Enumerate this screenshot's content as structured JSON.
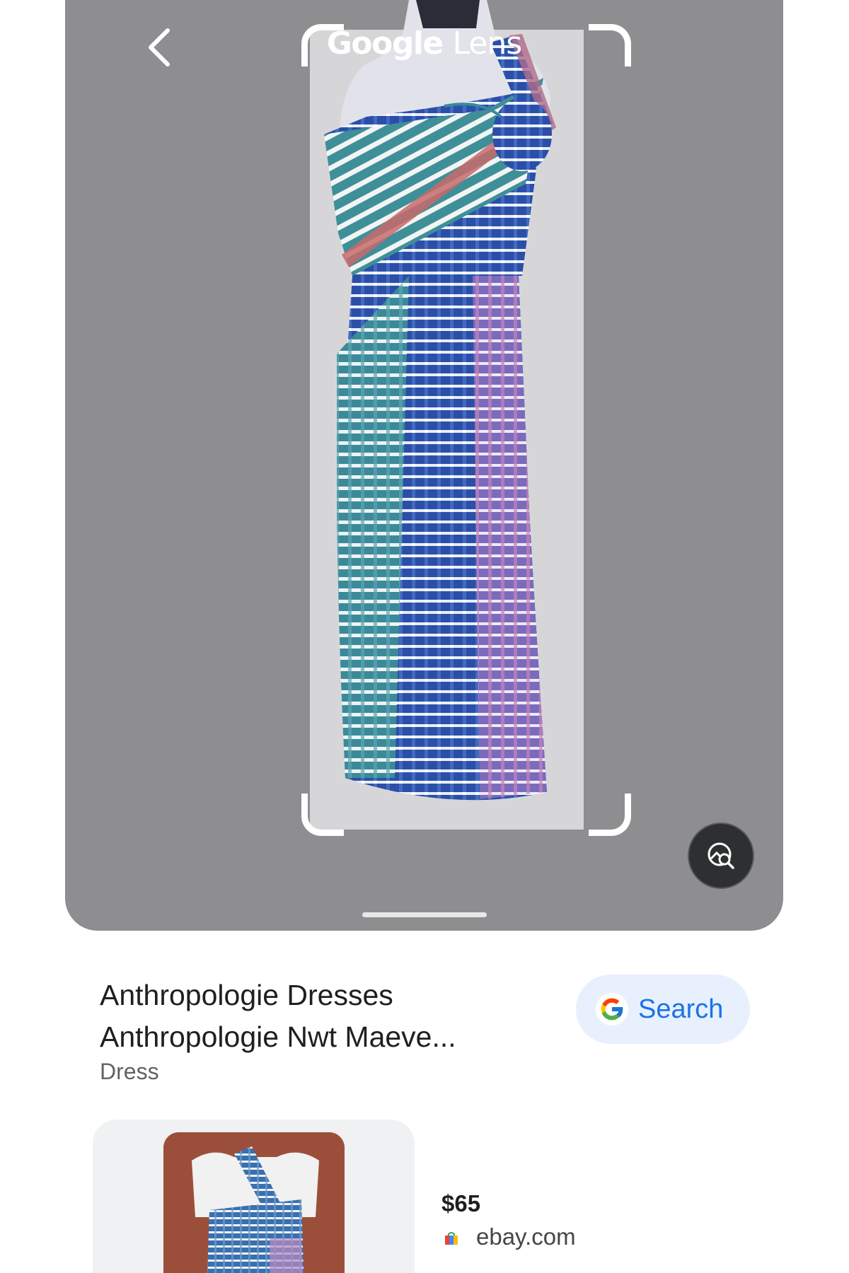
{
  "viewer": {
    "title_brand": "Google",
    "title_product": "Lens",
    "back_icon": "chevron-left-icon",
    "visual_search_icon": "image-search-icon"
  },
  "result": {
    "title": "Anthropologie Dresses Anthropologie Nwt Maeve...",
    "subtitle": "Dress",
    "search_button_label": "Search"
  },
  "products": [
    {
      "price": "$65",
      "merchant": "ebay.com",
      "merchant_icon": "shopping-bag-icon"
    }
  ],
  "colors": {
    "viewer_background": "#8e8e90",
    "accent_blue": "#1a73e8",
    "chip_background": "#e8f0fe"
  }
}
